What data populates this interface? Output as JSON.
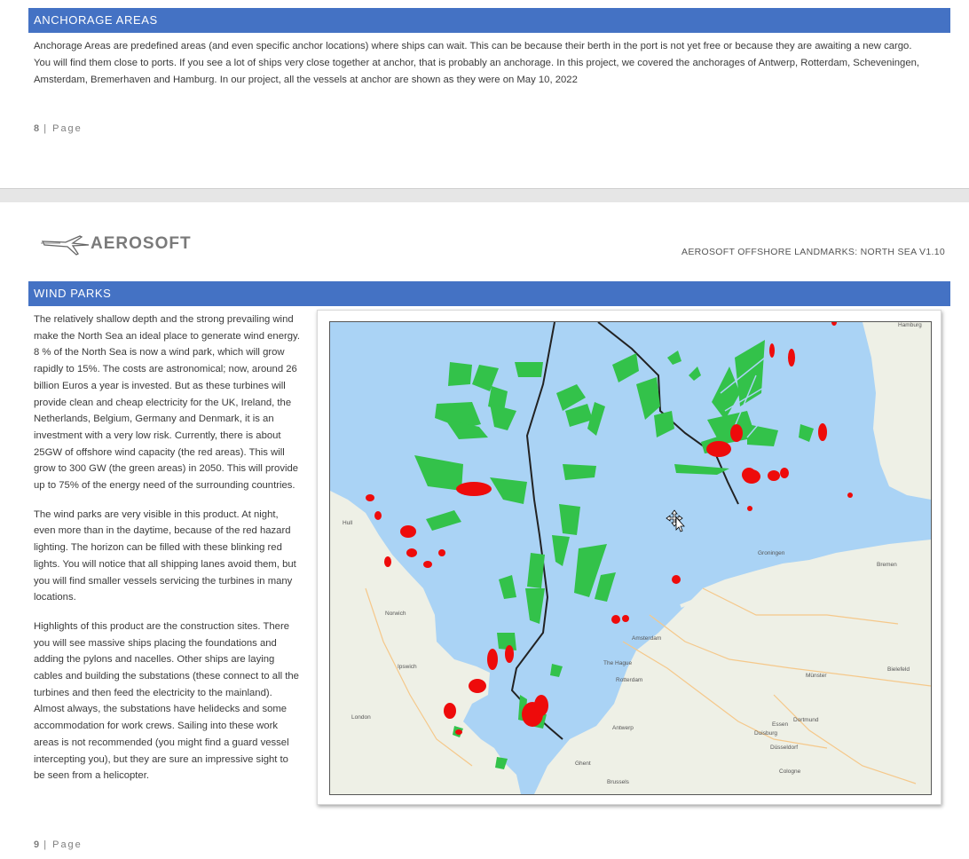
{
  "anchorage": {
    "heading": "ANCHORAGE  AREAS",
    "text": "Anchorage Areas are predefined areas (and even specific anchor locations) where ships can wait. This can be because their berth in the port is not yet free or because they are awaiting a new cargo. You will find them close to ports. If you see a lot of ships very close together at anchor, that is probably an anchorage. In this project, we covered the anchorages of Antwerp, Rotterdam, Scheveningen, Amsterdam, Bremerhaven and Hamburg. In our project, all the vessels at anchor are shown as they were on May 10, 2022",
    "page_number": "8",
    "page_label": "| Page"
  },
  "header": {
    "logo_text": "AEROSOFT",
    "doc_title": "AEROSOFT OFFSHORE LANDMARKS: NORTH SEA V1.10"
  },
  "windparks": {
    "heading": "WIND PARKS",
    "paragraphs": [
      "The relatively shallow depth and the strong prevailing wind make the North Sea an ideal place to generate wind energy. 8 % of the North Sea is now a wind park, which will grow rapidly to 15%. The costs are astronomical; now, around 26 billion Euros a year is invested. But as these turbines will provide clean and cheap electricity for the UK, Ireland, the Netherlands, Belgium, Germany and Denmark, it is an investment with a very low risk. Currently, there is about 25GW of offshore wind capacity (the red areas). This will grow to 300 GW (the green areas) in 2050. This will provide up to 75% of the energy need of the surrounding countries.",
      "The wind parks are very visible in this product. At night, even more than in the daytime, because of the red hazard lighting. The horizon can be filled with these blinking red lights. You will notice that all shipping lanes avoid them, but you will find smaller vessels servicing the turbines in many locations.",
      "Highlights of this product are the construction sites. There you will see massive ships placing the foundations and adding the pylons and nacelles. Other ships are laying cables and building the substations (these connect to all the turbines and then feed the electricity to the mainland). Almost always, the substations have helidecks and some accommodation for work crews. Sailing into these work areas is not recommended (you might find a guard vessel intercepting you), but they are sure an impressive sight to be seen from a helicopter."
    ],
    "page_number": "9",
    "page_label": "| Page"
  },
  "map": {
    "colors": {
      "sea": "#aad3f5",
      "land": "#eef0e6",
      "green_parks": "#33c24a",
      "red_parks": "#ee0b0b",
      "route": "#222222"
    },
    "labels": [
      "Amsterdam",
      "The Hague",
      "Rotterdam",
      "Antwerp",
      "Brussels",
      "Ghent",
      "Essen",
      "Dortmund",
      "Duisburg",
      "Düsseldorf",
      "Cologne",
      "Münster",
      "Bremen",
      "Groningen",
      "Bielefeld",
      "Hamburg",
      "London",
      "Norwich",
      "Ipswich",
      "Hull"
    ]
  }
}
